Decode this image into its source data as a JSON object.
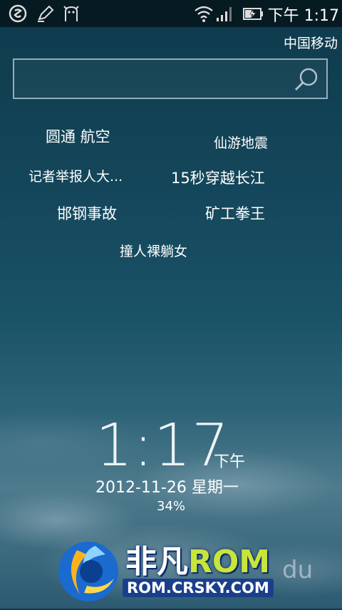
{
  "status_bar": {
    "time": "下午 1:17",
    "icons": [
      "shield-icon",
      "edit-icon",
      "usb-debug-icon",
      "wifi-icon",
      "signal-icon",
      "battery-charging-icon"
    ]
  },
  "carrier": "中国移动",
  "search": {
    "value": "",
    "placeholder": ""
  },
  "hot_words": [
    "圆通 航空",
    "仙游地震",
    "记者举报人大...",
    "15秒穿越长江",
    "邯钢事故",
    "矿工拳王",
    "撞人裸躺女"
  ],
  "clock": {
    "time": "1:17",
    "ampm": "下午",
    "date": "2012-11-26 星期一",
    "battery": "34%"
  },
  "watermark": {
    "brand_a": "非凡",
    "brand_b": "ROM",
    "url": "ROM.CRSKY.COM",
    "overlay_text": "du"
  },
  "colors": {
    "accent": "#c8e63a",
    "watermark_blue": "#1a3f8a"
  }
}
